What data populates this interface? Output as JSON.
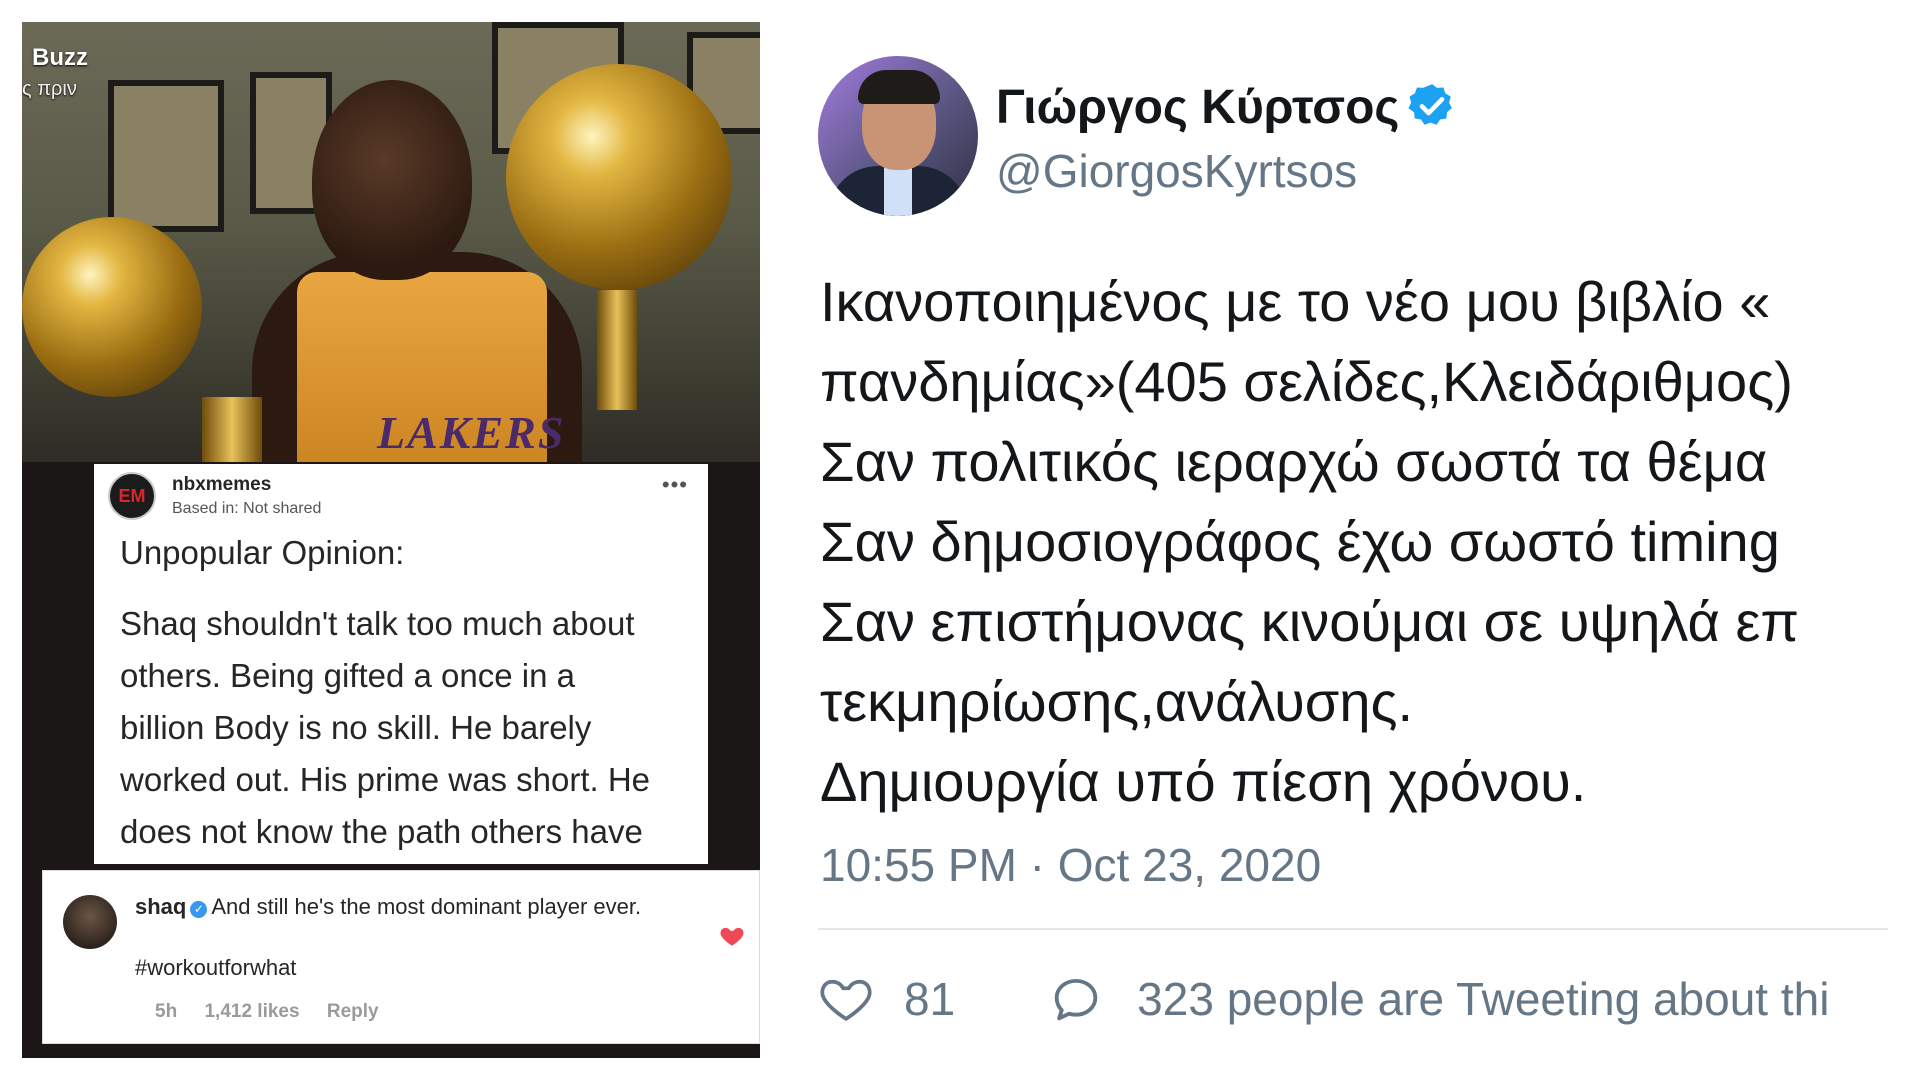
{
  "meme": {
    "source_label": "Buzz",
    "time_label": "ς πριν",
    "jersey_text": "LAKERS",
    "post": {
      "avatar_text": "EM",
      "username": "nbxmemes",
      "location": "Based in: Not shared",
      "more": "•••",
      "title": "Unpopular Opinion:",
      "body_lines": [
        "Shaq shouldn't talk too much about",
        "others. Being gifted a once in a",
        "billion Body is no skill. He barely",
        "worked out. His prime was short. He",
        "does not know the path others have"
      ]
    },
    "comment": {
      "username": "shaq",
      "verified_mark": "✓",
      "text": "And still he's the most dominant player ever.",
      "hashtag": "#workoutforwhat",
      "age": "5h",
      "likes": "1,412 likes",
      "reply": "Reply",
      "heart_color": "#ed4956"
    }
  },
  "tweet": {
    "name": "Γιώργος Κύρτσος",
    "handle": "@GiorgosKyrtsos",
    "verified_color": "#1da1f2",
    "lines": [
      "Ικανοποιημένος με το νέο μου βιβλίο «",
      "πανδημίας»(405 σελίδες,Κλειδάριθμος)",
      "Σαν πολιτικός ιεραρχώ σωστά τα θέμα",
      "Σαν δημοσιογράφος έχω σωστό timing",
      "Σαν επιστήμονας κινούμαι σε υψηλά επ",
      "τεκμηρίωσης,ανάλυσης.",
      "Δημιουργία υπό πίεση χρόνου."
    ],
    "timestamp": "10:55 PM · Oct 23, 2020",
    "like_count": "81",
    "conversation": "323 people are Tweeting about thi"
  }
}
